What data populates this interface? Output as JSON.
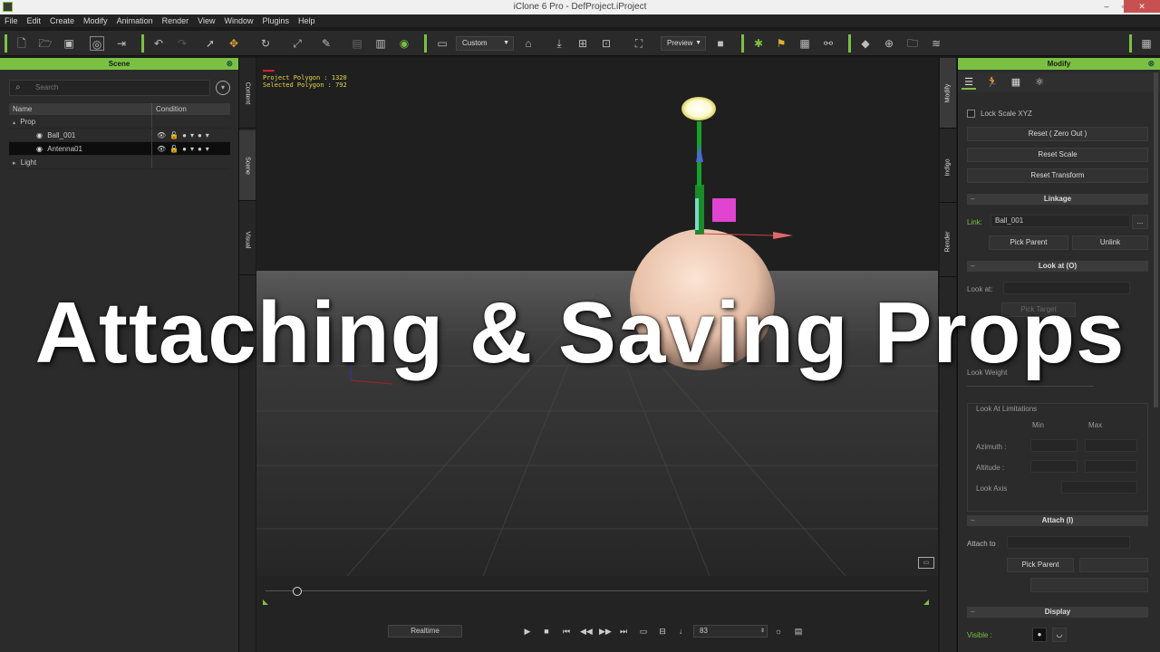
{
  "window": {
    "title": "iClone 6 Pro - DefProject.iProject",
    "minimize": "–",
    "maximize": "▫",
    "close": "✕"
  },
  "menu": [
    "File",
    "Edit",
    "Create",
    "Modify",
    "Animation",
    "Render",
    "View",
    "Window",
    "Plugins",
    "Help"
  ],
  "toolbar": {
    "camera_dropdown": "Custom",
    "preview_dropdown": "Preview"
  },
  "scene_panel": {
    "title": "Scene",
    "search_placeholder": "Search",
    "col_name": "Name",
    "col_condition": "Condition",
    "rows": [
      {
        "label": "Prop",
        "level": 0,
        "expander": "▴"
      },
      {
        "label": "Ball_001",
        "level": 2,
        "expander": ""
      },
      {
        "label": "Antenna01",
        "level": 2,
        "expander": ""
      },
      {
        "label": "Light",
        "level": 0,
        "expander": "▸"
      }
    ]
  },
  "left_vtabs": [
    "Content",
    "Scene",
    "Visual"
  ],
  "right_vtabs": [
    "Modify",
    "Indigo",
    "Render"
  ],
  "viewport": {
    "polygon_line1": "Project Polygon : 1320",
    "polygon_line2": "Selected Polygon : 792"
  },
  "timeline": {
    "realtime_label": "Realtime",
    "frame_value": "83"
  },
  "modify_panel": {
    "title": "Modify",
    "lock_scale": "Lock Scale XYZ",
    "reset_zero": "Reset ( Zero Out )",
    "reset_scale": "Reset Scale",
    "reset_transform": "Reset Transform",
    "linkage_title": "Linkage",
    "link_label": "Link:",
    "link_value": "Ball_001",
    "link_more": "...",
    "pick_parent": "Pick Parent",
    "unlink": "Unlink",
    "lookat_title": "Look at  (O)",
    "lookat_label": "Look at:",
    "pick_target": "Pick Target",
    "look_weight": "Look Weight",
    "look_limits": "Look At Limitations",
    "min": "Min",
    "max": "Max",
    "azimuth": "Azimuth :",
    "altitude": "Altitude :",
    "look_axis": "Look Axis",
    "attach_title": "Attach  (I)",
    "attach_to": "Attach to",
    "attach_pick_parent": "Pick Parent",
    "display_title": "Display",
    "visible_label": "Visible :"
  },
  "overlay": {
    "headline": "Attaching & Saving Props"
  },
  "colors": {
    "accent": "#7ac143",
    "panel": "#2b2b2b",
    "overlay_text": "#ffffff"
  }
}
